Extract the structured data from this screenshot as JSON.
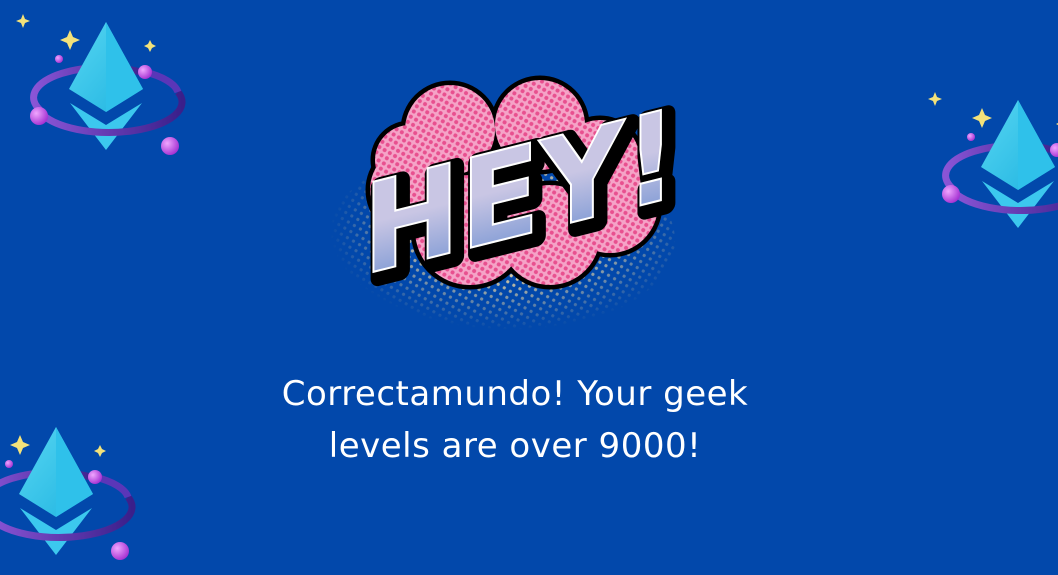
{
  "background_color": "#0248ab",
  "illustration": {
    "lettering": "HEY!",
    "decorations": [
      "ethereum-icon",
      "ethereum-icon",
      "ethereum-icon"
    ]
  },
  "message": {
    "line1": "Correctamundo! Your geek",
    "line2": "levels are over 9000!"
  }
}
